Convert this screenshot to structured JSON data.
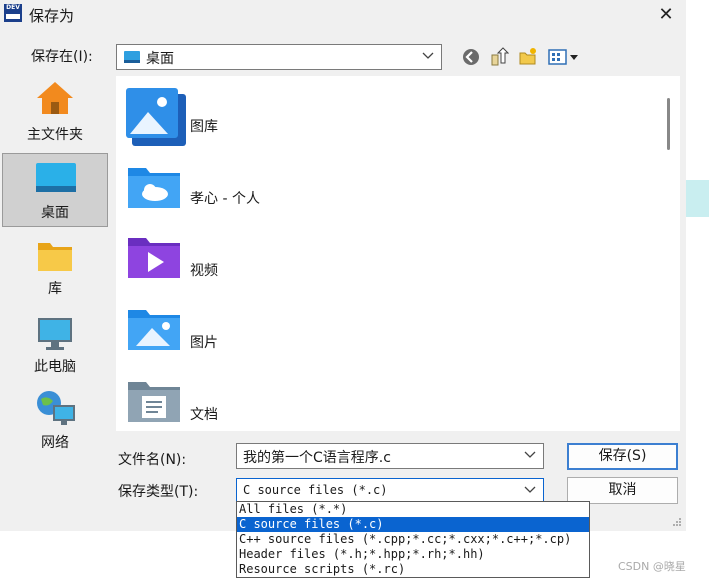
{
  "window": {
    "title": "保存为",
    "app_icon_text": "DEV"
  },
  "toolbar": {
    "save_in_label": "保存在(I):",
    "location": "桌面",
    "icons": [
      "back-icon",
      "up-folder-icon",
      "new-folder-icon",
      "view-menu-icon"
    ]
  },
  "sidebar": {
    "items": [
      {
        "label": "主文件夹",
        "icon": "home-icon"
      },
      {
        "label": "桌面",
        "icon": "desktop-icon",
        "selected": true
      },
      {
        "label": "库",
        "icon": "library-icon"
      },
      {
        "label": "此电脑",
        "icon": "computer-icon"
      },
      {
        "label": "网络",
        "icon": "network-icon"
      }
    ]
  },
  "files": [
    {
      "name": "图库",
      "icon": "gallery-icon"
    },
    {
      "name": "孝心 - 个人",
      "icon": "onedrive-folder-icon"
    },
    {
      "name": "视频",
      "icon": "videos-folder-icon"
    },
    {
      "name": "图片",
      "icon": "pictures-folder-icon"
    },
    {
      "name": "文档",
      "icon": "documents-folder-icon"
    }
  ],
  "form": {
    "filename_label": "文件名(N):",
    "filename_value": "我的第一个C语言程序.c",
    "filetype_label": "保存类型(T):",
    "filetype_value": "C source files (*.c)",
    "save_button": "保存(S)",
    "cancel_button": "取消"
  },
  "filetype_options": [
    "All files (*.*)",
    "C source files (*.c)",
    "C++ source files (*.cpp;*.cc;*.cxx;*.c++;*.cp)",
    "Header files (*.h;*.hpp;*.rh;*.hh)",
    "Resource scripts (*.rc)"
  ],
  "filetype_selected_index": 1,
  "watermark": "CSDN @晓星",
  "colors": {
    "accent": "#0a64d0",
    "folder_blue": "#1e88e5",
    "selected_side": "#d0d0d0"
  }
}
